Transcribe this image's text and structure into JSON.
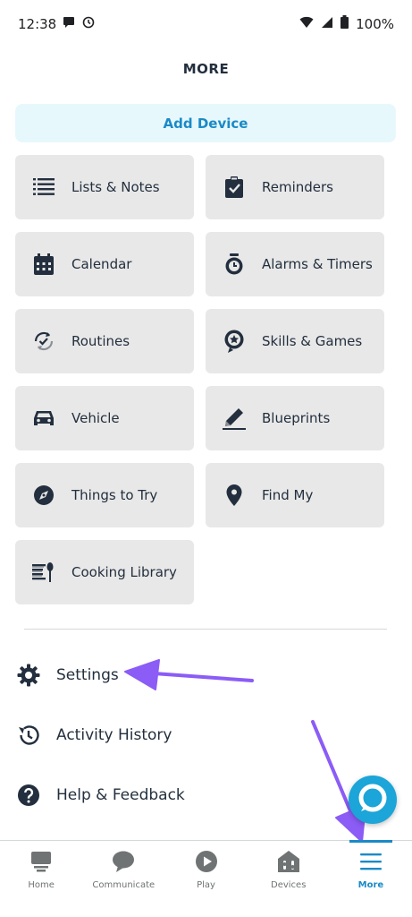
{
  "status_bar": {
    "time": "12:38",
    "battery": "100%"
  },
  "header": {
    "title": "MORE"
  },
  "add_device": {
    "label": "Add Device"
  },
  "tiles": [
    {
      "label": "Lists & Notes",
      "icon": "list-icon"
    },
    {
      "label": "Reminders",
      "icon": "clipboard-check-icon"
    },
    {
      "label": "Calendar",
      "icon": "calendar-icon"
    },
    {
      "label": "Alarms & Timers",
      "icon": "alarm-clock-icon"
    },
    {
      "label": "Routines",
      "icon": "routines-icon"
    },
    {
      "label": "Skills & Games",
      "icon": "skills-icon"
    },
    {
      "label": "Vehicle",
      "icon": "car-icon"
    },
    {
      "label": "Blueprints",
      "icon": "pencil-icon"
    },
    {
      "label": "Things to Try",
      "icon": "compass-icon"
    },
    {
      "label": "Find My",
      "icon": "location-pin-icon"
    },
    {
      "label": "Cooking Library",
      "icon": "cooking-icon"
    }
  ],
  "list": [
    {
      "label": "Settings",
      "icon": "gear-icon"
    },
    {
      "label": "Activity History",
      "icon": "history-icon"
    },
    {
      "label": "Help & Feedback",
      "icon": "help-icon"
    }
  ],
  "tabs": [
    {
      "label": "Home",
      "icon": "home-icon"
    },
    {
      "label": "Communicate",
      "icon": "chat-bubble-icon"
    },
    {
      "label": "Play",
      "icon": "play-icon"
    },
    {
      "label": "Devices",
      "icon": "devices-icon"
    },
    {
      "label": "More",
      "icon": "menu-icon",
      "active": true
    }
  ],
  "colors": {
    "accent": "#1a8ac7",
    "alexa": "#1ba5d8",
    "tile": "#e8e8e8",
    "annotation_arrow": "#8b5cf6"
  }
}
